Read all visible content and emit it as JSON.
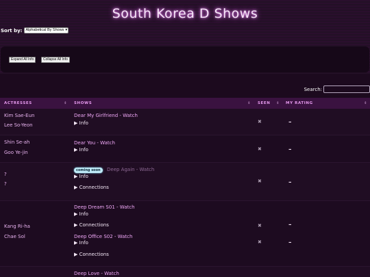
{
  "page": {
    "title": "South Korea D Shows"
  },
  "sort": {
    "label": "Sort by:",
    "selected": "Alphabetical By Shows"
  },
  "buttons": {
    "expand": "Expand All Info",
    "collapse": "Collapse All Info"
  },
  "search": {
    "label": "Search:"
  },
  "table": {
    "headers": {
      "actresses": "ACTRESSES",
      "shows": "SHOWS",
      "seen": "SEEN",
      "rating": "MY RATING"
    },
    "rows": [
      {
        "actresses": [
          "Kim Sae-Eun",
          "Lee So-Yeon"
        ],
        "show": "Dear My Girlfriend - Watch",
        "info": "Info",
        "seen": "✖",
        "rating": "–"
      },
      {
        "actresses": [
          "Shin Se-ah",
          "Goo Ye-jin"
        ],
        "show": "Dear You - Watch",
        "info": "Info",
        "seen": "✖",
        "rating": "–"
      },
      {
        "actresses": [
          "?",
          "?"
        ],
        "badge": "coming soon",
        "show": "Deep Again - Watch",
        "info": "Info",
        "connections": "Connections",
        "seen": "✖",
        "rating": "–"
      },
      {
        "actresses": [
          "Kang Ri-ha",
          "Chae Sol"
        ],
        "shows": [
          {
            "title": "Deep Dream S01 - Watch",
            "info": "Info",
            "connections": "Connections",
            "seen": "✖",
            "rating": "–"
          },
          {
            "title": "Deep Office S02 - Watch",
            "info": "Info",
            "connections": "Connections",
            "seen": "✖",
            "rating": "–"
          }
        ]
      },
      {
        "show": "Deep Love - Watch"
      }
    ]
  },
  "icons": {
    "disclosure": "▶",
    "sort": "⇕"
  }
}
